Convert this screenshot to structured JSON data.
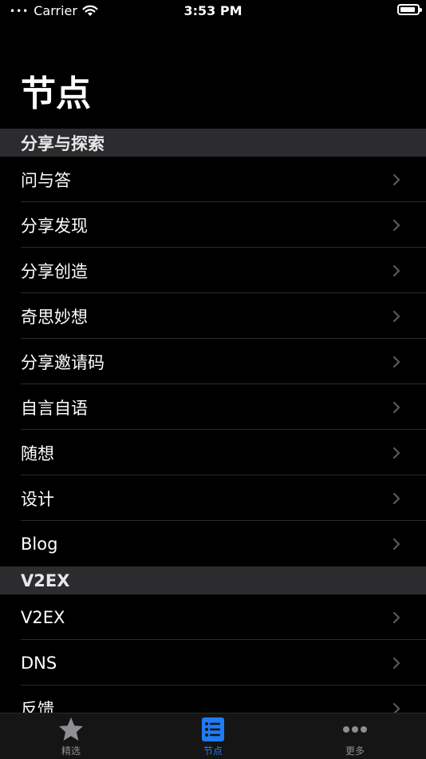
{
  "status": {
    "carrier": "Carrier",
    "time": "3:53 PM",
    "battery_level_percent": 90
  },
  "page": {
    "title": "节点"
  },
  "sections": [
    {
      "header": "分享与探索",
      "items": [
        "问与答",
        "分享发现",
        "分享创造",
        "奇思妙想",
        "分享邀请码",
        "自言自语",
        "随想",
        "设计",
        "Blog"
      ]
    },
    {
      "header": "V2EX",
      "items": [
        "V2EX",
        "DNS",
        "反馈"
      ]
    }
  ],
  "tabs": [
    {
      "label": "精选",
      "icon": "star-icon",
      "active": false
    },
    {
      "label": "节点",
      "icon": "list-icon",
      "active": true
    },
    {
      "label": "更多",
      "icon": "more-dots-icon",
      "active": false
    }
  ],
  "colors": {
    "background": "#000000",
    "section_header_bg": "#2c2c2e",
    "accent": "#1f7bf6",
    "inactive_tab": "#8e8e93",
    "chevron": "#5a5a5e"
  }
}
